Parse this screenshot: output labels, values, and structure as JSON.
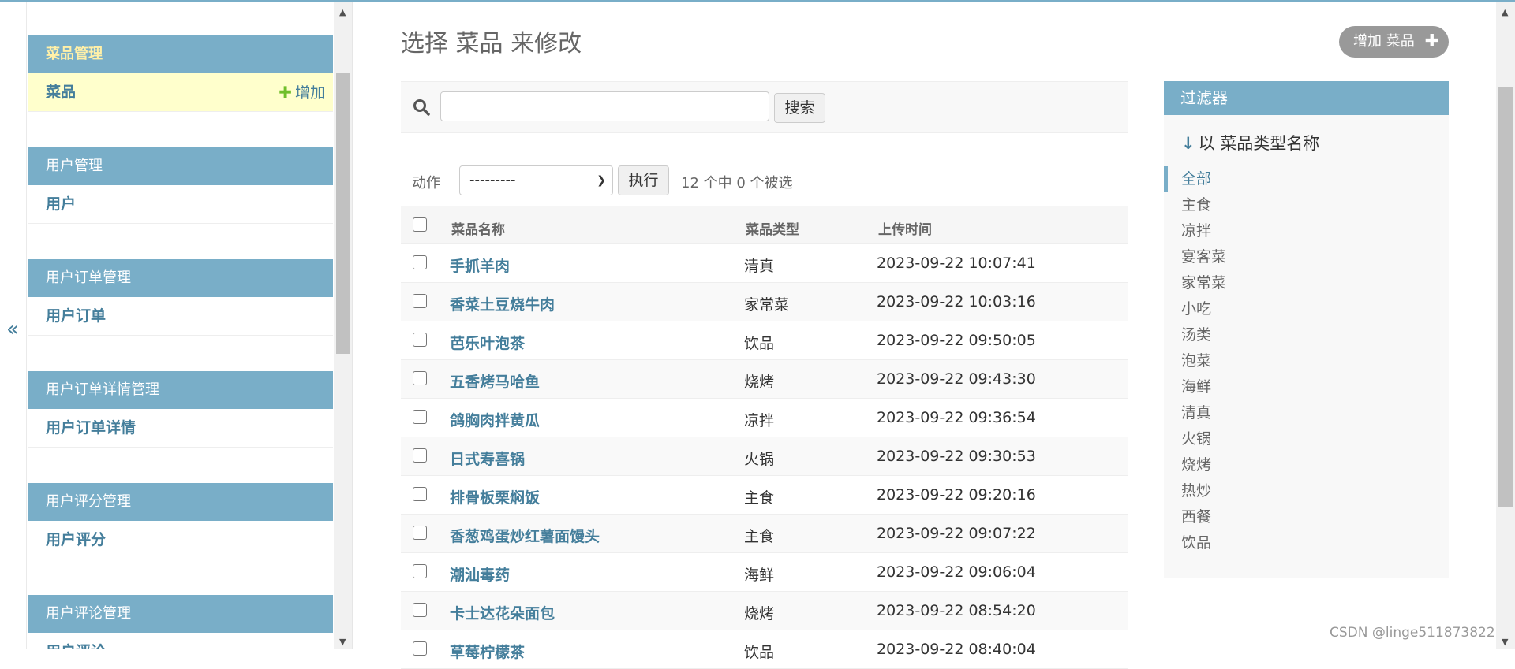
{
  "sidebar": {
    "collapse_toggle": "«",
    "modules": [
      {
        "header": "菜品管理",
        "item": "菜品",
        "add_label": "增加"
      },
      {
        "header": "用户管理",
        "item": "用户"
      },
      {
        "header": "用户订单管理",
        "item": "用户订单"
      },
      {
        "header": "用户订单详情管理",
        "item": "用户订单详情"
      },
      {
        "header": "用户评分管理",
        "item": "用户评分"
      },
      {
        "header": "用户评论管理",
        "item": "用户评论"
      }
    ]
  },
  "main": {
    "title": "选择 菜品 来修改",
    "add_button": "增加 菜品",
    "search": {
      "value": "",
      "button": "搜索"
    },
    "actions": {
      "label": "动作",
      "selected": "---------",
      "go_button": "执行",
      "counter": "12 个中 0 个被选"
    },
    "table": {
      "columns": [
        "菜品名称",
        "菜品类型",
        "上传时间"
      ],
      "rows": [
        {
          "name": "手抓羊肉",
          "type": "清真",
          "time": "2023-09-22 10:07:41"
        },
        {
          "name": "香菜土豆烧牛肉",
          "type": "家常菜",
          "time": "2023-09-22 10:03:16"
        },
        {
          "name": "芭乐叶泡茶",
          "type": "饮品",
          "time": "2023-09-22 09:50:05"
        },
        {
          "name": "五香烤马哈鱼",
          "type": "烧烤",
          "time": "2023-09-22 09:43:30"
        },
        {
          "name": "鸽胸肉拌黄瓜",
          "type": "凉拌",
          "time": "2023-09-22 09:36:54"
        },
        {
          "name": "日式寿喜锅",
          "type": "火锅",
          "time": "2023-09-22 09:30:53"
        },
        {
          "name": "排骨板栗焖饭",
          "type": "主食",
          "time": "2023-09-22 09:20:16"
        },
        {
          "name": "香葱鸡蛋炒红薯面馒头",
          "type": "主食",
          "time": "2023-09-22 09:07:22"
        },
        {
          "name": "潮汕毒药",
          "type": "海鲜",
          "time": "2023-09-22 09:06:04"
        },
        {
          "name": "卡士达花朵面包",
          "type": "烧烤",
          "time": "2023-09-22 08:54:20"
        },
        {
          "name": "草莓柠檬茶",
          "type": "饮品",
          "time": "2023-09-22 08:40:04"
        }
      ]
    }
  },
  "filter": {
    "header": "过滤器",
    "title": "以 菜品类型名称",
    "options": [
      "全部",
      "主食",
      "凉拌",
      "宴客菜",
      "家常菜",
      "小吃",
      "汤类",
      "泡菜",
      "海鲜",
      "清真",
      "火锅",
      "烧烤",
      "热炒",
      "西餐",
      "饮品"
    ],
    "selected": "全部"
  },
  "watermark": "CSDN @linge511873822",
  "colors": {
    "accent": "#79aec8",
    "link": "#447e9b",
    "current_row": "#ffffcc",
    "current_header_text": "#fff0a8",
    "add_plus": "#70bf2b"
  }
}
